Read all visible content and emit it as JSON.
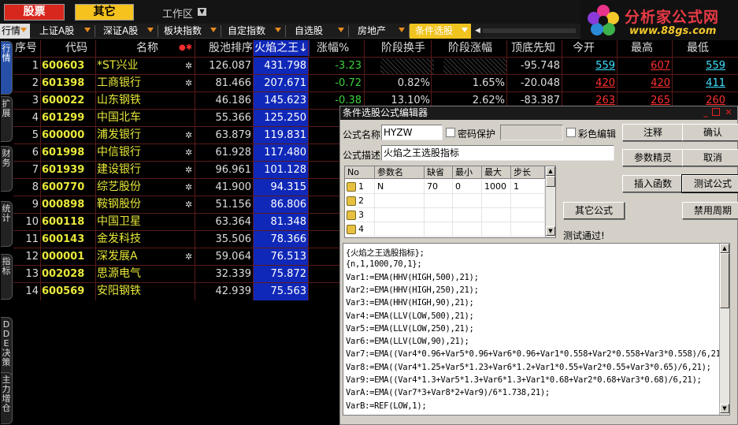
{
  "top": {
    "btn_stock": "股票",
    "btn_other": "其它",
    "workspace": "工作区"
  },
  "logo": {
    "title": "分析家公式网",
    "url": "www.88gs.com"
  },
  "tabs": [
    "行情",
    "上证A股",
    "深证A股",
    "板块指数",
    "自定指数",
    "自选股",
    "房地产",
    "条件选股"
  ],
  "sidetabs": [
    "行情",
    "扩展",
    "财务",
    "统计",
    "指标",
    "DDE决策",
    "主力增仓"
  ],
  "grid": {
    "headers": {
      "seq": "序号",
      "code": "代码",
      "name": "名称",
      "pool": "股池排序",
      "fire": "火焰之王↓",
      "chg": "涨幅%",
      "turn": "阶段换手",
      "rise": "阶段涨幅",
      "top": "顶底先知",
      "open": "今开",
      "high": "最高",
      "low": "最低"
    },
    "rows": [
      {
        "seq": "1",
        "code": "600603",
        "name": "*ST兴业",
        "star": true,
        "pool": "126.087",
        "fire": "431.798",
        "chg": "-3.23",
        "turn": "",
        "rise": "",
        "top": "-95.748",
        "open": "559",
        "high": "607",
        "low": "559"
      },
      {
        "seq": "2",
        "code": "601398",
        "name": "工商银行",
        "star": true,
        "pool": "81.466",
        "fire": "207.671",
        "chg": "-0.72",
        "turn": "0.82%",
        "rise": "1.65%",
        "top": "-20.048",
        "open": "420",
        "high": "420",
        "low": "411"
      },
      {
        "seq": "3",
        "code": "600022",
        "name": "山东钢铁",
        "star": false,
        "pool": "46.186",
        "fire": "145.623",
        "chg": "-0.38",
        "turn": "13.10%",
        "rise": "2.62%",
        "top": "-83.387",
        "open": "263",
        "high": "265",
        "low": "260"
      },
      {
        "seq": "4",
        "code": "601299",
        "name": "中国北车",
        "star": false,
        "pool": "55.366",
        "fire": "125.250",
        "chg": "",
        "turn": "",
        "rise": "",
        "top": "",
        "open": "",
        "high": "",
        "low": ""
      },
      {
        "seq": "5",
        "code": "600000",
        "name": "浦发银行",
        "star": true,
        "pool": "63.879",
        "fire": "119.831",
        "chg": "",
        "turn": "",
        "rise": "",
        "top": "",
        "open": "",
        "high": "",
        "low": ""
      },
      {
        "seq": "6",
        "code": "601998",
        "name": "中信银行",
        "star": true,
        "pool": "61.928",
        "fire": "117.480",
        "chg": "",
        "turn": "",
        "rise": "",
        "top": "",
        "open": "",
        "high": "",
        "low": ""
      },
      {
        "seq": "7",
        "code": "601939",
        "name": "建设银行",
        "star": true,
        "pool": "96.961",
        "fire": "101.128",
        "chg": "",
        "turn": "",
        "rise": "",
        "top": "",
        "open": "",
        "high": "",
        "low": ""
      },
      {
        "seq": "8",
        "code": "600770",
        "name": "综艺股份",
        "star": true,
        "pool": "41.900",
        "fire": "94.315",
        "chg": "",
        "turn": "",
        "rise": "",
        "top": "",
        "open": "",
        "high": "",
        "low": ""
      },
      {
        "seq": "9",
        "code": "000898",
        "name": "鞍钢股份",
        "star": true,
        "pool": "51.156",
        "fire": "86.806",
        "chg": "",
        "turn": "",
        "rise": "",
        "top": "",
        "open": "",
        "high": "",
        "low": ""
      },
      {
        "seq": "10",
        "code": "600118",
        "name": "中国卫星",
        "star": false,
        "pool": "63.364",
        "fire": "81.348",
        "chg": "",
        "turn": "",
        "rise": "",
        "top": "",
        "open": "",
        "high": "",
        "low": ""
      },
      {
        "seq": "11",
        "code": "600143",
        "name": "金发科技",
        "star": false,
        "pool": "35.506",
        "fire": "78.366",
        "chg": "",
        "turn": "",
        "rise": "",
        "top": "",
        "open": "",
        "high": "",
        "low": ""
      },
      {
        "seq": "12",
        "code": "000001",
        "name": "深发展A",
        "star": true,
        "pool": "59.064",
        "fire": "76.513",
        "chg": "",
        "turn": "",
        "rise": "",
        "top": "",
        "open": "",
        "high": "",
        "low": ""
      },
      {
        "seq": "13",
        "code": "002028",
        "name": "思源电气",
        "star": false,
        "pool": "32.339",
        "fire": "75.872",
        "chg": "",
        "turn": "",
        "rise": "",
        "top": "",
        "open": "",
        "high": "",
        "low": ""
      },
      {
        "seq": "14",
        "code": "600569",
        "name": "安阳钢铁",
        "star": false,
        "pool": "42.939",
        "fire": "75.563",
        "chg": "",
        "turn": "",
        "rise": "",
        "top": "",
        "open": "",
        "high": "",
        "low": ""
      }
    ]
  },
  "dialog": {
    "title": "条件选股公式编辑器",
    "name_label": "公式名称",
    "name_value": "HYZW",
    "pwd_label": "密码保护",
    "color_label": "彩色编辑",
    "desc_label": "公式描述",
    "desc_value": "火焰之王选股指标",
    "btn_comment": "注释",
    "btn_ok": "确认",
    "btn_param": "参数精灵",
    "btn_cancel": "取消",
    "btn_insert": "插入函数",
    "btn_test": "测试公式",
    "btn_other": "其它公式",
    "btn_cycle": "禁用周期",
    "status": "测试通过!",
    "param_headers": [
      "No",
      "参数名",
      "缺省",
      "最小",
      "最大",
      "步长"
    ],
    "params": [
      {
        "no": "1",
        "name": "N",
        "def": "70",
        "min": "0",
        "max": "1000",
        "step": "1"
      },
      {
        "no": "2",
        "name": "",
        "def": "",
        "min": "",
        "max": "",
        "step": ""
      },
      {
        "no": "3",
        "name": "",
        "def": "",
        "min": "",
        "max": "",
        "step": ""
      },
      {
        "no": "4",
        "name": "",
        "def": "",
        "min": "",
        "max": "",
        "step": ""
      }
    ],
    "code": [
      "{火焰之王选股指标};",
      "{n,1,1000,70,1};",
      "Var1:=EMA(HHV(HIGH,500),21);",
      "Var2:=EMA(HHV(HIGH,250),21);",
      "Var3:=EMA(HHV(HIGH,90),21);",
      "Var4:=EMA(LLV(LOW,500),21);",
      "Var5:=EMA(LLV(LOW,250),21);",
      "Var6:=EMA(LLV(LOW,90),21);",
      "Var7:=EMA((Var4*0.96+Var5*0.96+Var6*0.96+Var1*0.558+Var2*0.558+Var3*0.558)/6,21",
      "Var8:=EMA((Var4*1.25+Var5*1.23+Var6*1.2+Var1*0.55+Var2*0.55+Var3*0.65)/6,21);",
      "Var9:=EMA((Var4*1.3+Var5*1.3+Var6*1.3+Var1*0.68+Var2*0.68+Var3*0.68)/6,21);",
      "VarA:=EMA((Var7*3+Var8*2+Var9)/6*1.738,21);",
      "VarB:=REF(LOW,1);"
    ]
  },
  "colors": {
    "accent_red": "#d8281e",
    "accent_yellow": "#f5c21e",
    "fire_col": "#1028b8",
    "code_yellow": "#e8e83a"
  }
}
